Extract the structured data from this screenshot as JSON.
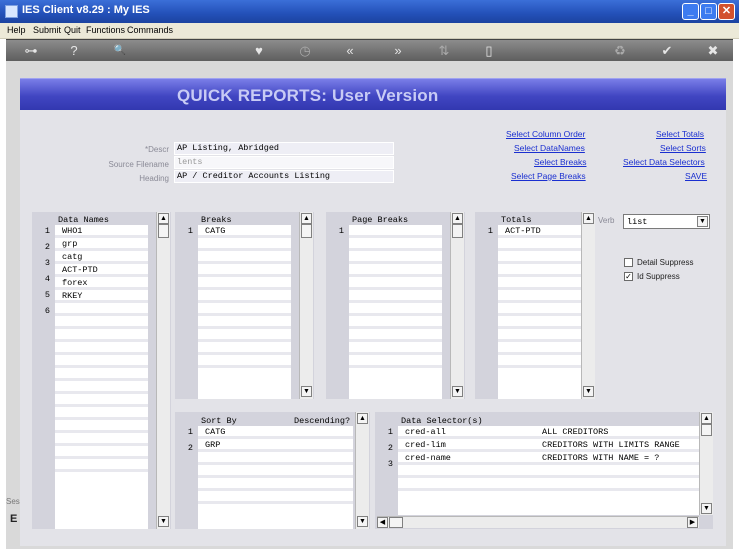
{
  "window": {
    "title": "IES Client v8.29 : My IES",
    "minimize": "_",
    "maximize": "□",
    "close": "✕"
  },
  "menu": [
    "Help",
    "Submit",
    "Quit",
    "Functions",
    "Commands"
  ],
  "toolbar": {
    "icons": [
      "key-icon",
      "help-icon",
      "search-icon",
      "heart-icon",
      "clock-icon",
      "rewind-icon",
      "fast-forward-icon",
      "upload-icon",
      "new-document-icon",
      "recycle-icon",
      "check-icon",
      "close-circle-icon"
    ],
    "glyphs": [
      "⊶",
      "?",
      "🔍",
      "♥",
      "◷",
      "«",
      "»",
      "⇅",
      "▯",
      "♻",
      "✔",
      "✖"
    ]
  },
  "banner": {
    "title": "QUICK REPORTS: User Version"
  },
  "form": {
    "descr_label": "*Descr",
    "descr_value": "AP Listing, Abridged",
    "source_label": "Source Filename",
    "source_value": "lents",
    "heading_label": "Heading",
    "heading_value": "AP / Creditor Accounts Listing"
  },
  "links": {
    "select_column_order": "Select Column Order",
    "select_datanames": "Select DataNames",
    "select_breaks": "Select Breaks",
    "select_page_breaks": "Select Page Breaks",
    "select_totals": "Select Totals",
    "select_sorts": "Select Sorts",
    "select_data_selectors": "Select Data Selectors",
    "save": "SAVE"
  },
  "verb": {
    "label": "Verb",
    "value": "list"
  },
  "options": {
    "detail_suppress": "Detail Suppress",
    "detail_suppress_checked": false,
    "id_suppress": "Id Suppress",
    "id_suppress_checked": true
  },
  "data_names": {
    "header": "Data Names",
    "items": [
      "WHO1",
      "grp",
      "catg",
      "ACT-PTD",
      "forex",
      "RKEY"
    ]
  },
  "breaks": {
    "header": "Breaks",
    "items": [
      "CATG"
    ]
  },
  "page_breaks": {
    "header": "Page Breaks",
    "items": [
      ""
    ]
  },
  "totals": {
    "header": "Totals",
    "items": [
      "ACT-PTD"
    ]
  },
  "sort_by": {
    "header": "Sort By",
    "desc_header": "Descending?",
    "items": [
      "CATG",
      "GRP"
    ]
  },
  "data_selectors": {
    "header": "Data Selector(s)",
    "items": [
      {
        "name": "cred-all",
        "desc": "ALL CREDITORS"
      },
      {
        "name": "cred-lim",
        "desc": "CREDITORS WITH LIMITS RANGE"
      },
      {
        "name": "cred-name",
        "desc": "CREDITORS WITH NAME = ?"
      }
    ]
  },
  "side_tab": {
    "text": "Ses",
    "letter": "E"
  }
}
